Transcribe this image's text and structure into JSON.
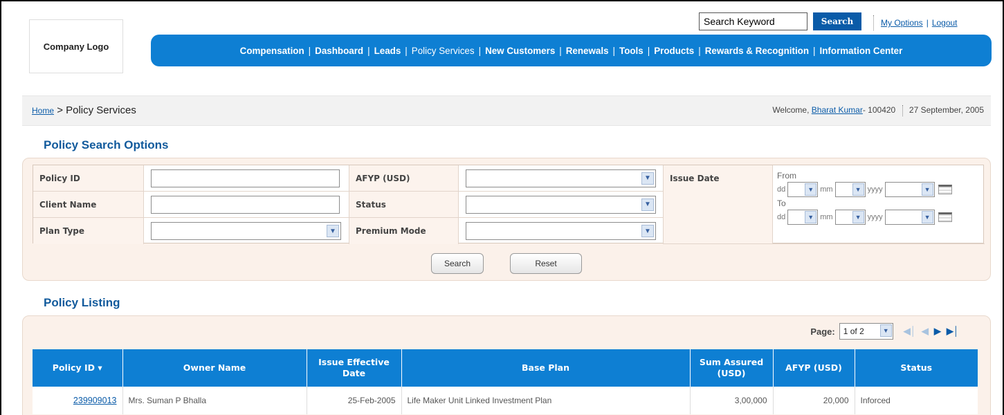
{
  "logo": {
    "label": "Company Logo"
  },
  "top": {
    "search_value": "Search Keyword",
    "search_button": "Search",
    "links": [
      "My Options",
      "Logout"
    ]
  },
  "nav": {
    "items": [
      "Compensation",
      "Dashboard",
      "Leads",
      "Policy Services",
      "New Customers",
      "Renewals",
      "Tools",
      "Products",
      "Rewards & Recognition",
      "Information Center"
    ]
  },
  "breadcrumb": {
    "home": "Home",
    "separator": ">",
    "current": "Policy Services"
  },
  "welcome": {
    "prefix": "Welcome,",
    "user": "Bharat Kumar",
    "user_id": "- 100420",
    "date": "27 September, 2005"
  },
  "search": {
    "title": "Policy Search Options",
    "labels": {
      "policy_id": "Policy ID",
      "client_name": "Client Name",
      "plan_type": "Plan Type",
      "afyp": "AFYP (USD)",
      "status": "Status",
      "premium_mode": "Premium Mode",
      "issue_date": "Issue Date",
      "from": "From",
      "to": "To",
      "dd": "dd",
      "mm": "mm",
      "yyyy": "yyyy"
    },
    "buttons": {
      "search": "Search",
      "reset": "Reset"
    }
  },
  "listing": {
    "title": "Policy Listing",
    "page_label": "Page:",
    "page_value": "1 of 2",
    "columns": [
      "Policy ID ▾",
      "Owner Name",
      "Issue Effective Date",
      "Base Plan",
      "Sum Assured (USD)",
      "AFYP (USD)",
      "Status"
    ],
    "rows": [
      {
        "policy_id": "239909013",
        "owner": "Mrs. Suman P Bhalla",
        "date": "25-Feb-2005",
        "plan": "Life Maker Unit Linked Investment Plan",
        "sum": "3,00,000",
        "afyp": "20,000",
        "status": "Inforced"
      }
    ]
  }
}
